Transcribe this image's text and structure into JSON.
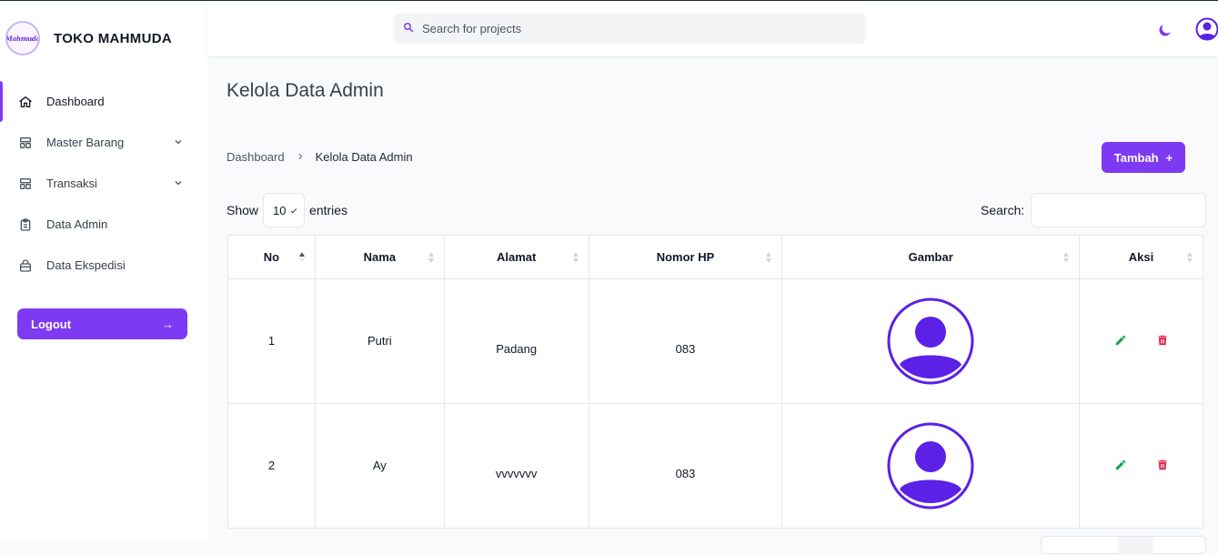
{
  "app": {
    "brand_name": "TOKO MAHMUDA",
    "logo_text": "Mahmuda"
  },
  "header": {
    "search_placeholder": "Search for projects"
  },
  "sidebar": {
    "items": [
      {
        "label": "Dashboard",
        "icon": "home-icon",
        "active": true
      },
      {
        "label": "Master Barang",
        "icon": "template-icon",
        "expandable": true
      },
      {
        "label": "Transaksi",
        "icon": "template-icon",
        "expandable": true
      },
      {
        "label": "Data Admin",
        "icon": "clipboard-icon"
      },
      {
        "label": "Data Ekspedisi",
        "icon": "shopping-bag-icon"
      }
    ],
    "logout_label": "Logout",
    "logout_arrow": "→"
  },
  "page": {
    "title": "Kelola Data Admin"
  },
  "breadcrumb": {
    "home": "Dashboard",
    "current": "Kelola Data Admin"
  },
  "add_button": {
    "label": "Tambah",
    "plus": "+"
  },
  "table_controls": {
    "show_label": "Show",
    "entries_value": "10",
    "entries_label": "entries",
    "search_label": "Search:"
  },
  "table": {
    "columns": [
      "No",
      "Nama",
      "Alamat",
      "Nomor HP",
      "Gambar",
      "Aksi"
    ],
    "rows": [
      {
        "no": "1",
        "nama": "Putri",
        "alamat": "Padang",
        "nomor_hp": "083"
      },
      {
        "no": "2",
        "nama": "Ay",
        "alamat": "vvvvvvv",
        "nomor_hp": "083"
      }
    ]
  },
  "colors": {
    "accent": "#7e3af2",
    "avatar": "#5b21e6",
    "edit": "#16a34a",
    "delete": "#e11d48"
  }
}
